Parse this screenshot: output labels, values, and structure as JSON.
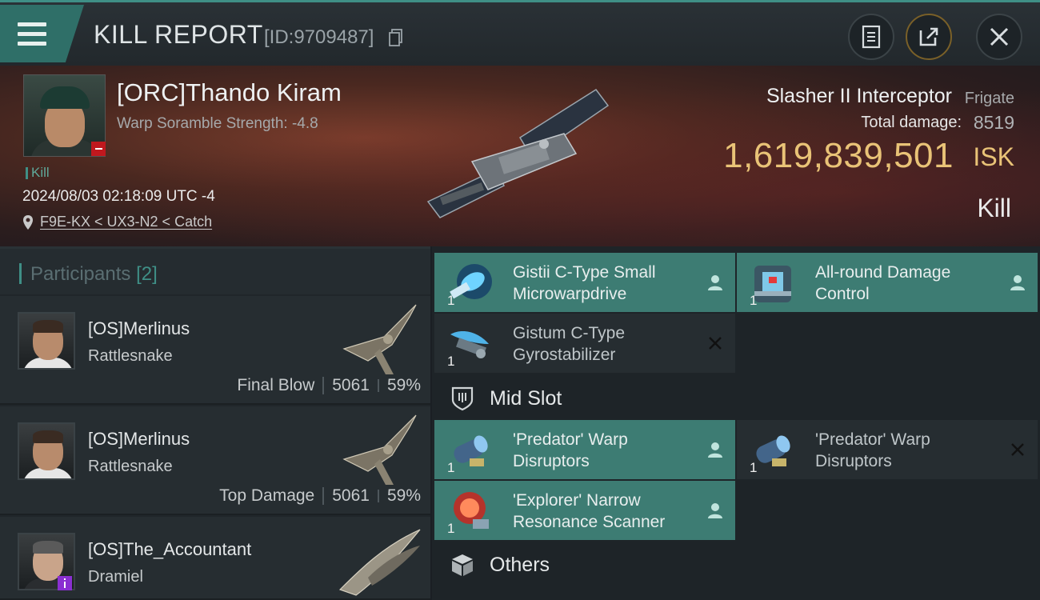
{
  "header": {
    "title": "KILL REPORT",
    "report_id": "[ID:9709487]"
  },
  "victim": {
    "name": "[ORC]Thando Kiram",
    "warp_scramble": "Warp Soramble Strength: -4.8",
    "kill_tag": "Kill",
    "datetime": "2024/08/03 02:18:09 UTC -4",
    "location": "F9E-KX < UX3-N2 < Catch",
    "ship_name": "Slasher II Interceptor",
    "ship_class": "Frigate",
    "total_damage_label": "Total damage:",
    "total_damage": "8519",
    "isk_value": "1,619,839,501",
    "isk_unit": "ISK",
    "result": "Kill"
  },
  "participants": {
    "label": "Participants",
    "count": "[2]",
    "rows": [
      {
        "name": "[OS]Merlinus",
        "ship": "Rattlesnake",
        "role": "Final Blow",
        "damage": "5061",
        "percent": "59%"
      },
      {
        "name": "[OS]Merlinus",
        "ship": "Rattlesnake",
        "role": "Top Damage",
        "damage": "5061",
        "percent": "59%"
      },
      {
        "name": "[OS]The_Accountant",
        "ship": "Dramiel"
      }
    ]
  },
  "modules": {
    "low": [
      {
        "name_line1": "Gistii C-Type Small",
        "name_line2": "Microwarpdrive",
        "qty": "1",
        "state": "dropped",
        "icon": "microwarpdrive-icon"
      },
      {
        "name_line1": "All-round Damage",
        "name_line2": "Control",
        "qty": "1",
        "state": "dropped",
        "icon": "damage-control-icon"
      },
      {
        "name_line1": "Gistum C-Type",
        "name_line2": "Gyrostabilizer",
        "qty": "1",
        "state": "destroyed",
        "icon": "gyrostabilizer-icon"
      }
    ],
    "mid_label": "Mid Slot",
    "mid": [
      {
        "name_line1": "'Predator' Warp",
        "name_line2": "Disruptors",
        "qty": "1",
        "state": "dropped",
        "icon": "warp-disruptor-icon"
      },
      {
        "name_line1": "'Predator' Warp",
        "name_line2": "Disruptors",
        "qty": "1",
        "state": "destroyed",
        "icon": "warp-disruptor-icon"
      },
      {
        "name_line1": "'Explorer' Narrow",
        "name_line2": "Resonance Scanner",
        "qty": "1",
        "state": "dropped",
        "icon": "scanner-icon"
      }
    ],
    "others_label": "Others"
  },
  "colors": {
    "accent": "#3f8f86",
    "isk": "#e9c377",
    "dropped_bg": "#3d7c73",
    "destroyed_bg": "#262d31"
  }
}
